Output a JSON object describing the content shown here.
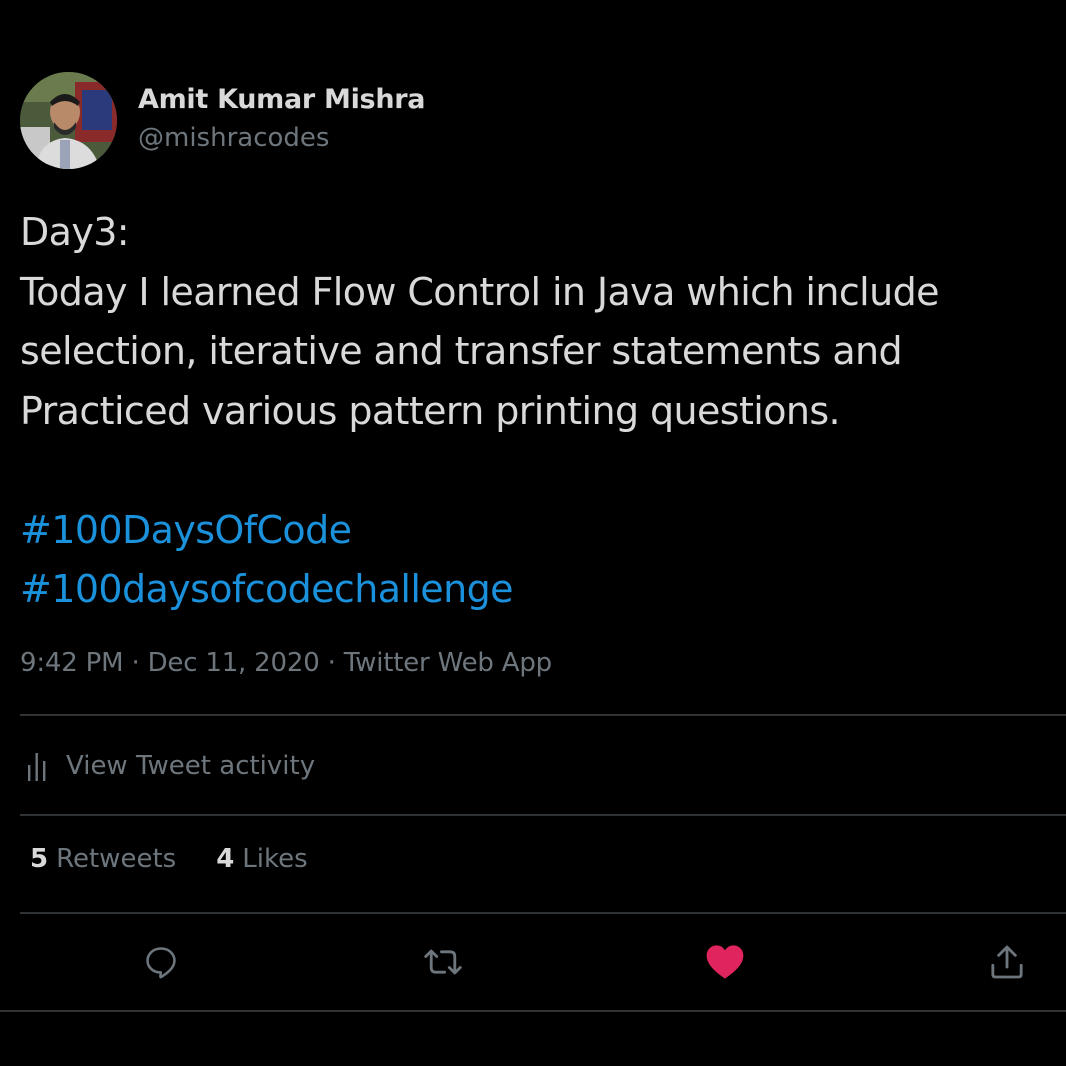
{
  "author": {
    "display_name": "Amit Kumar Mishra",
    "handle": "@mishracodes"
  },
  "tweet": {
    "lines": [
      "Day3:",
      "Today I learned Flow Control in Java which include",
      "selection, iterative and transfer statements and",
      "Practiced various pattern printing questions."
    ],
    "hashtags": [
      "#100DaysOfCode",
      "#100daysofcodechallenge"
    ]
  },
  "meta": {
    "time": "9:42 PM",
    "separator": "·",
    "date": "Dec 11, 2020",
    "source": "Twitter Web App"
  },
  "activity": {
    "label": "View Tweet activity",
    "icon": "bar-chart-icon"
  },
  "stats": {
    "retweets_count": "5",
    "retweets_label": "Retweets",
    "likes_count": "4",
    "likes_label": "Likes"
  },
  "actions": {
    "reply_icon": "reply-icon",
    "retweet_icon": "retweet-icon",
    "like_icon": "heart-icon",
    "share_icon": "share-icon",
    "liked": true
  },
  "colors": {
    "background": "#000000",
    "text": "#d9d9d9",
    "secondary": "#6e767d",
    "hashtag": "#1a91da",
    "like": "#e0245e",
    "divider": "#2f3336"
  }
}
